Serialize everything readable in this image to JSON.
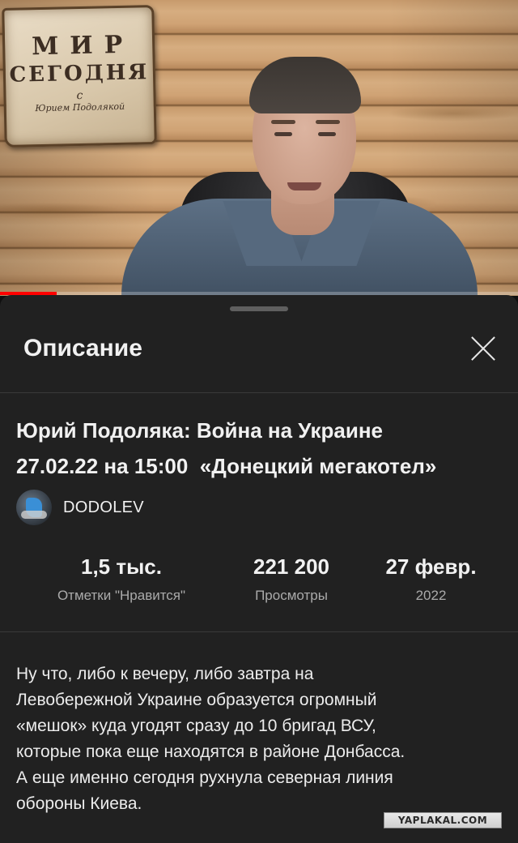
{
  "video": {
    "sign": {
      "line1": "МИР",
      "line2": "СЕГОДНЯ",
      "line3": "с",
      "line4": "Юрием Подолякой"
    },
    "progress_fraction": 0.11,
    "progress_color": "#ff0000"
  },
  "sheet": {
    "title": "Описание",
    "close_icon": "close-icon",
    "video_title_line1": "Юрий Подоляка: Война на Украине",
    "video_title_line2": "27.02.22 на 15:00  «Донецкий мегакотел»",
    "channel": {
      "name": "DODOLEV"
    },
    "stats": [
      {
        "value": "1,5 тыс.",
        "label": "Отметки \"Нравится\""
      },
      {
        "value": "221 200",
        "label": "Просмотры"
      },
      {
        "value": "27 февр.",
        "label": "2022"
      }
    ],
    "description_lines": [
      "Ну что, либо к вечеру, либо завтра на",
      "Левобережной Украине образуется огромный",
      "«мешок» куда угодят сразу до 10 бригад ВСУ,",
      "которые пока еще находятся в районе Донбасса.",
      "А еще именно сегодня рухнула северная линия",
      "обороны Киева."
    ]
  },
  "watermark": "YAPLAKAL.COM"
}
